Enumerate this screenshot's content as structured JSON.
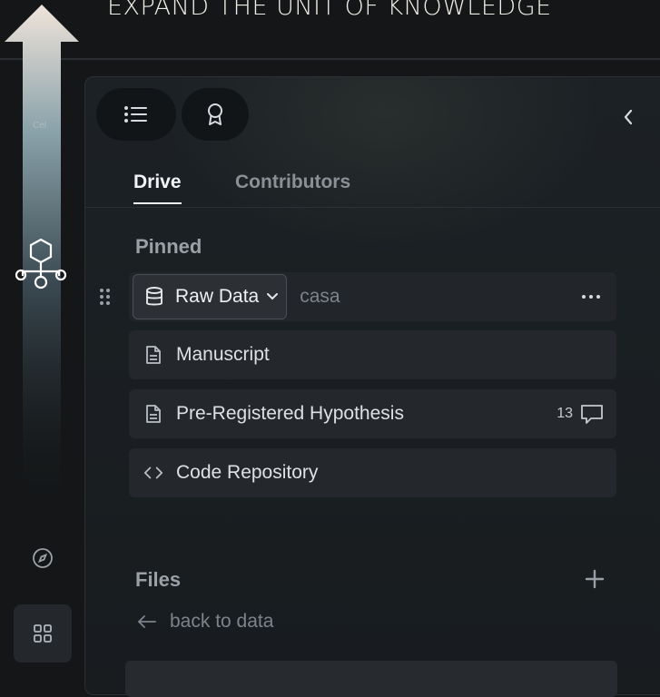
{
  "banner": {
    "text": "EXPAND THE UNIT OF KNOWLEDGE"
  },
  "rail": {
    "label": "Cel",
    "icons": [
      "network-nodes-icon",
      "compass-icon",
      "grid-icon"
    ]
  },
  "toolbar": {
    "icons": [
      "list-icon",
      "award-icon",
      "chevron-left-icon"
    ]
  },
  "tabs": [
    {
      "label": "Drive",
      "active": true
    },
    {
      "label": "Contributors",
      "active": false
    }
  ],
  "pinned": {
    "title": "Pinned",
    "items": [
      {
        "icon": "database-icon",
        "label": "Raw Data",
        "value": "casa"
      },
      {
        "icon": "document-icon",
        "label": "Manuscript"
      },
      {
        "icon": "document-icon",
        "label": "Pre-Registered Hypothesis",
        "comment_count": "13"
      },
      {
        "icon": "code-icon",
        "label": "Code Repository"
      }
    ]
  },
  "files": {
    "title": "Files",
    "back_link": "back to data"
  },
  "colors": {
    "background": "#141618",
    "panel": "#1c2125",
    "row": "#24282c",
    "text": "#dde1e5",
    "muted": "#7d838a"
  }
}
